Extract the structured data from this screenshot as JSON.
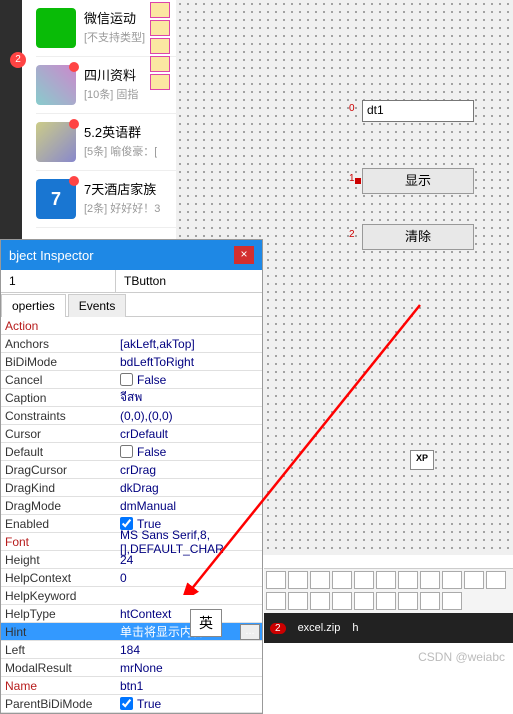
{
  "sidebar_badge": "2",
  "chats": [
    {
      "title": "微信运动",
      "sub": "[不支持类型]"
    },
    {
      "title": "四川资料",
      "sub": "[10条] 固指"
    },
    {
      "title": "5.2英语群",
      "sub": "[5条] 喻俊豪：["
    },
    {
      "title": "7天酒店家族",
      "sub": "[2条] 好好好！3",
      "seven": "7"
    }
  ],
  "designer": {
    "edit_label": "0",
    "edit_name": "dt1",
    "btn1_num": "1",
    "btn1_label": "显示",
    "btn2_num": "2",
    "btn2_label": "清除",
    "xp": "XP"
  },
  "inspector": {
    "title": "bject Inspector",
    "combo_name": "1",
    "combo_type": "TButton",
    "tabs": {
      "props": "operties",
      "events": "Events"
    },
    "props": [
      {
        "name": "Action",
        "val": "",
        "red": true
      },
      {
        "name": "Anchors",
        "val": "[akLeft,akTop]"
      },
      {
        "name": "BiDiMode",
        "val": "bdLeftToRight"
      },
      {
        "name": "Cancel",
        "val": "False",
        "chk": true,
        "checked": false
      },
      {
        "name": "Caption",
        "val": "จีสพ"
      },
      {
        "name": "Constraints",
        "val": "(0,0),(0,0)"
      },
      {
        "name": "Cursor",
        "val": "crDefault"
      },
      {
        "name": "Default",
        "val": "False",
        "chk": true,
        "checked": false
      },
      {
        "name": "DragCursor",
        "val": "crDrag"
      },
      {
        "name": "DragKind",
        "val": "dkDrag"
      },
      {
        "name": "DragMode",
        "val": "dmManual"
      },
      {
        "name": "Enabled",
        "val": "True",
        "chk": true,
        "checked": true
      },
      {
        "name": "Font",
        "val": "MS Sans Serif,8,[],DEFAULT_CHAR",
        "red": true
      },
      {
        "name": "Height",
        "val": "24"
      },
      {
        "name": "HelpContext",
        "val": "0"
      },
      {
        "name": "HelpKeyword",
        "val": ""
      },
      {
        "name": "HelpType",
        "val": "htContext"
      },
      {
        "name": "Hint",
        "val": "单击将显示内容",
        "sel": true,
        "ell": true
      },
      {
        "name": "Left",
        "val": "184"
      },
      {
        "name": "ModalResult",
        "val": "mrNone"
      },
      {
        "name": "Name",
        "val": "btn1",
        "red": true
      },
      {
        "name": "ParentBiDiMode",
        "val": "True",
        "chk": true,
        "checked": true
      }
    ]
  },
  "ime": "英",
  "ellipsis": "...",
  "task": {
    "num": "2",
    "file": "excel.zip",
    "h": "h"
  },
  "watermark": "CSDN @weiabc"
}
